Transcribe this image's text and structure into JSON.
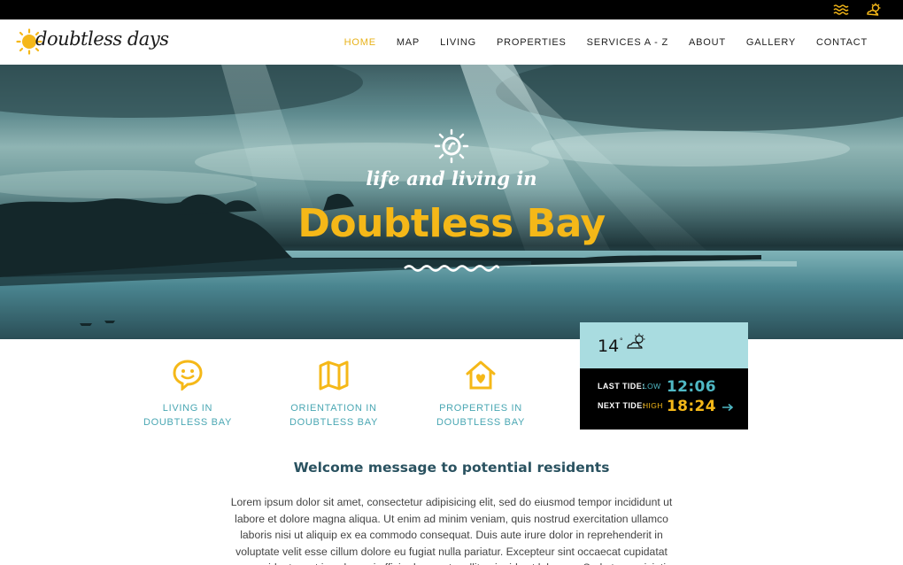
{
  "colors": {
    "accent": "#f5b818",
    "teal": "#4aa7b3",
    "dark": "#000000",
    "heading": "#2a5260"
  },
  "topbar": {
    "icons": [
      "waves-icon",
      "sun-cloud-icon"
    ]
  },
  "header": {
    "logo_text": "doubtless days",
    "nav": [
      {
        "label": "HOME",
        "active": true
      },
      {
        "label": "MAP"
      },
      {
        "label": "LIVING"
      },
      {
        "label": "PROPERTIES"
      },
      {
        "label": "SERVICES A - Z"
      },
      {
        "label": "ABOUT"
      },
      {
        "label": "GALLERY"
      },
      {
        "label": "CONTACT"
      }
    ]
  },
  "hero": {
    "tagline": "life and living in",
    "title": "Doubtless Bay"
  },
  "features": [
    {
      "icon": "smiley-speech-icon",
      "line1": "LIVING IN",
      "line2": "DOUBTLESS BAY"
    },
    {
      "icon": "folded-map-icon",
      "line1": "ORIENTATION IN",
      "line2": "DOUBTLESS BAY"
    },
    {
      "icon": "house-heart-icon",
      "line1": "PROPERTIES IN",
      "line2": "DOUBTLESS BAY"
    }
  ],
  "weather": {
    "temperature": "14",
    "degree_symbol": "°",
    "last_tide_label": "LAST TIDE:",
    "last_tide_level": "LOW",
    "last_tide_time": "12:06",
    "next_tide_label": "NEXT TIDE:",
    "next_tide_level": "HIGH",
    "next_tide_time": "18:24"
  },
  "welcome": {
    "title": "Welcome message to potential residents",
    "body": "Lorem ipsum dolor sit amet, consectetur adipisicing elit, sed do eiusmod tempor incididunt ut labore et dolore magna aliqua. Ut enim ad minim veniam, quis nostrud exercitation ullamco laboris nisi ut aliquip ex ea commodo consequat. Duis aute irure dolor in reprehenderit in voluptate velit esse cillum dolore eu fugiat nulla pariatur. Excepteur sint occaecat cupidatat non proident, sunt in culpa qui officia deserunt mollit anim id est laborum. Sed ut perspiciatis unde omnis iste natus error"
  }
}
